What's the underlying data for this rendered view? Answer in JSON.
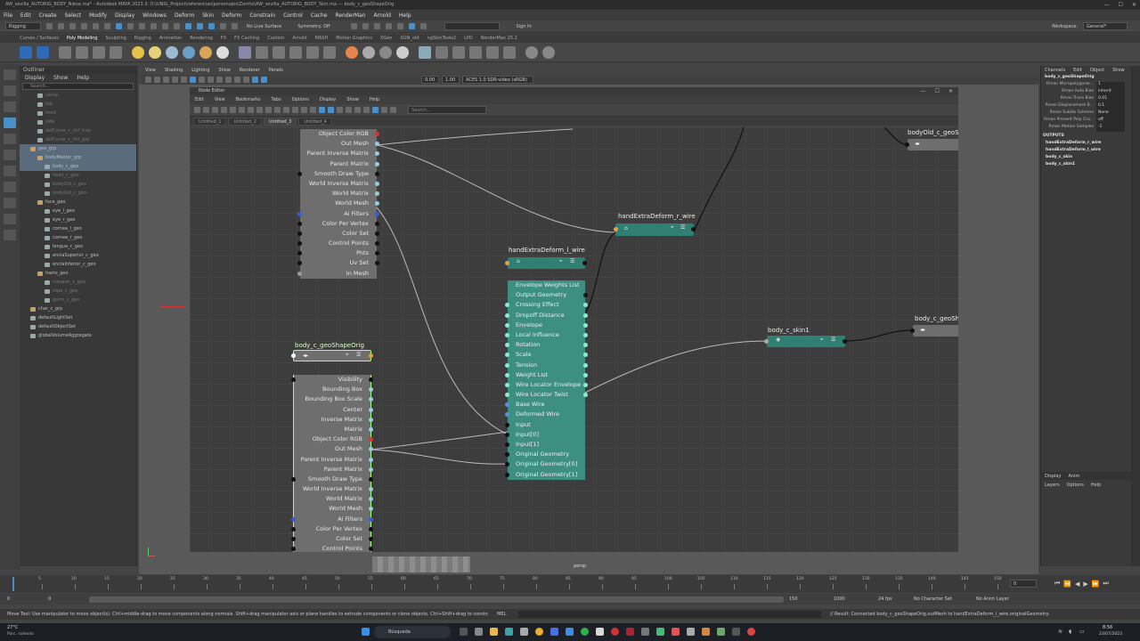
{
  "app": {
    "title": "AW_sevilla_AUTORIG_BODY_Nieve.ma* - Autodesk MAYA 2023.3: D:\\UNIG_Project\\referencias\\personajes\\Zorrito\\AW_sevilla_AUTORIG_BODY_Skin.ma  ---  body_c_geoShapeOrig"
  },
  "menubar": [
    "File",
    "Edit",
    "Create",
    "Select",
    "Modify",
    "Display",
    "Windows",
    "Deform",
    "Skin",
    "Deform",
    "Constrain",
    "Control",
    "Cache",
    "RenderMan",
    "Arnold",
    "Help"
  ],
  "statusline": {
    "mode": "Rigging",
    "live_surface": "No Live Surface",
    "symmetry": "Symmetry: Off",
    "sign_in": "Sign In",
    "workspace_label": "Workspace:",
    "workspace": "General*"
  },
  "shelf_tabs": [
    {
      "label": "Curves / Surfaces",
      "active": false
    },
    {
      "label": "Poly Modeling",
      "active": true
    },
    {
      "label": "Sculpting",
      "active": false
    },
    {
      "label": "Rigging",
      "active": false
    },
    {
      "label": "Animation",
      "active": false
    },
    {
      "label": "Rendering",
      "active": false
    },
    {
      "label": "FX",
      "active": false
    },
    {
      "label": "FX Caching",
      "active": false
    },
    {
      "label": "Custom",
      "active": false
    },
    {
      "label": "Arnold",
      "active": false
    },
    {
      "label": "MASH",
      "active": false
    },
    {
      "label": "Motion Graphics",
      "active": false
    },
    {
      "label": "XGen",
      "active": false
    },
    {
      "label": "XGN_old",
      "active": false
    },
    {
      "label": "ngSkinTools2",
      "active": false
    },
    {
      "label": "LPD",
      "active": false
    },
    {
      "label": "RenderMan 25.2",
      "active": false
    }
  ],
  "outliner": {
    "title": "Outliner",
    "menu": [
      "Display",
      "Show",
      "Help"
    ],
    "search_placeholder": "Search...",
    "items": [
      {
        "label": "camp",
        "indent": 2,
        "dim": true,
        "sel": false,
        "grp": false
      },
      {
        "label": "top",
        "indent": 2,
        "dim": true,
        "sel": false,
        "grp": false
      },
      {
        "label": "front",
        "indent": 2,
        "dim": true,
        "sel": false,
        "grp": false
      },
      {
        "label": "side",
        "indent": 2,
        "dim": true,
        "sel": false,
        "grp": false
      },
      {
        "label": "defCurve_c_ctrl_tmp",
        "indent": 2,
        "dim": true,
        "sel": false,
        "grp": false
      },
      {
        "label": "defCurve_c_ctrl_grp",
        "indent": 2,
        "dim": true,
        "sel": false,
        "grp": false
      },
      {
        "label": "geo_grp",
        "indent": 1,
        "dim": false,
        "sel": true,
        "grp": true
      },
      {
        "label": "bodyMaster_grp",
        "indent": 2,
        "dim": false,
        "sel": true,
        "grp": true
      },
      {
        "label": "body_c_geo",
        "indent": 3,
        "dim": false,
        "sel": true,
        "grp": false
      },
      {
        "label": "head_c_geo",
        "indent": 3,
        "dim": true,
        "sel": false,
        "grp": false
      },
      {
        "label": "bodyOld_c_geo",
        "indent": 3,
        "dim": true,
        "sel": false,
        "grp": false
      },
      {
        "label": "bodyOld_c_geo",
        "indent": 3,
        "dim": true,
        "sel": false,
        "grp": false
      },
      {
        "label": "face_geo",
        "indent": 2,
        "dim": false,
        "sel": false,
        "grp": true
      },
      {
        "label": "eye_l_geo",
        "indent": 3,
        "dim": false,
        "sel": false,
        "grp": false
      },
      {
        "label": "eye_r_geo",
        "indent": 3,
        "dim": false,
        "sel": false,
        "grp": false
      },
      {
        "label": "cornea_l_geo",
        "indent": 3,
        "dim": false,
        "sel": false,
        "grp": false
      },
      {
        "label": "cornea_r_geo",
        "indent": 3,
        "dim": false,
        "sel": false,
        "grp": false
      },
      {
        "label": "lengua_c_geo",
        "indent": 3,
        "dim": false,
        "sel": false,
        "grp": false
      },
      {
        "label": "encíaSuperior_c_geo",
        "indent": 3,
        "dim": false,
        "sel": false,
        "grp": false
      },
      {
        "label": "encíaInferior_c_geo",
        "indent": 3,
        "dim": false,
        "sel": false,
        "grp": false
      },
      {
        "label": "hams_geo",
        "indent": 2,
        "dim": false,
        "sel": false,
        "grp": true
      },
      {
        "label": "mesaon_c_geo",
        "indent": 3,
        "dim": true,
        "sel": false,
        "grp": false
      },
      {
        "label": "ropa_c_geo",
        "indent": 3,
        "dim": true,
        "sel": false,
        "grp": false
      },
      {
        "label": "gorro_c_geo",
        "indent": 3,
        "dim": true,
        "sel": false,
        "grp": false
      },
      {
        "label": "char_c_grp",
        "indent": 1,
        "dim": false,
        "sel": false,
        "grp": true
      },
      {
        "label": "defaultLightSet",
        "indent": 1,
        "dim": false,
        "sel": false,
        "grp": false
      },
      {
        "label": "defaultObjectSet",
        "indent": 1,
        "dim": false,
        "sel": false,
        "grp": false
      },
      {
        "label": "globalVolumeAggregate",
        "indent": 1,
        "dim": false,
        "sel": false,
        "grp": false
      }
    ]
  },
  "viewport": {
    "menu": [
      "View",
      "Shading",
      "Lighting",
      "Show",
      "Renderer",
      "Panels"
    ],
    "exposure": "0.00",
    "gamma": "1.00",
    "colorspace": "ACES 1.0 SDR-video (sRGB)",
    "camera": "persp"
  },
  "node_editor": {
    "title": "Node Editor",
    "menu": [
      "Edit",
      "View",
      "Bookmarks",
      "Tabs",
      "Options",
      "Display",
      "Show",
      "Help"
    ],
    "search_placeholder": "Search...",
    "tabs": [
      {
        "label": "Untitled_1",
        "active": false
      },
      {
        "label": "Untitled_2",
        "active": false
      },
      {
        "label": "Untitled_3",
        "active": true
      },
      {
        "label": "Untitled_4",
        "active": false
      }
    ],
    "nodes": {
      "upper": {
        "attrs": [
          "Object Color RGB",
          "Out Mesh",
          "Parent Inverse Matrix",
          "Parent Matrix",
          "Smooth Draw Type",
          "World Inverse Matrix",
          "World Matrix",
          "World Mesh",
          "Ai Filters",
          "Color Per Vertex",
          "Color Set",
          "Control Points",
          "Pnts",
          "Uv Set",
          "In Mesh"
        ]
      },
      "orig": {
        "title": "body_c_geoShapeOrig",
        "attrs": [
          "Visibility",
          "Bounding Box",
          "Bounding Box Scale",
          "Center",
          "Inverse Matrix",
          "Matrix",
          "Object Color RGB",
          "Out Mesh",
          "Parent Inverse Matrix",
          "Parent Matrix",
          "Smooth Draw Type",
          "World Inverse Matrix",
          "World Matrix",
          "World Mesh",
          "Ai Filters",
          "Color Per Vertex",
          "Color Set",
          "Control Points"
        ]
      },
      "wire_l": {
        "title": "handExtraDeform_l_wire",
        "attrs": [
          "Envelope Weights List",
          "Output Geometry",
          "Crossing Effect",
          "Dropoff Distance",
          "Envelope",
          "Local Influence",
          "Rotation",
          "Scale",
          "Tension",
          "Weight List",
          "Wire Locator Envelope",
          "Wire Locator Twist",
          "Base Wire",
          "Deformed Wire",
          "Input",
          "Input[0]",
          "Input[1]",
          "Original Geometry",
          "Original Geometry[0]",
          "Original Geometry[1]"
        ]
      },
      "wire_r": {
        "title": "handExtraDeform_r_wire"
      },
      "skin": {
        "title": "body_c_skin1"
      },
      "bodyold": {
        "title": "bodyOld_c_geoS"
      },
      "geosh": {
        "title": "body_c_geoSh"
      }
    }
  },
  "channel_box": {
    "menu": [
      "Channels",
      "Edit",
      "Object",
      "Show"
    ],
    "node": "body_c_geoShapeOrig",
    "rows": [
      {
        "k": "Rman Micropolygonle...",
        "v": "1"
      },
      {
        "k": "Rman Auto Bias",
        "v": "inherit"
      },
      {
        "k": "Rman Trace Bias",
        "v": "0.01"
      },
      {
        "k": "Rman Displacement B...",
        "v": "0.1"
      },
      {
        "k": "Rman Subdiv Scheme",
        "v": "None"
      },
      {
        "k": "Rman Prevent Poly Cra...",
        "v": "off"
      },
      {
        "k": "Rman Motion Samples",
        "v": "-1"
      }
    ],
    "outputs_label": "OUTPUTS",
    "outputs": [
      "handExtraDeform_r_wire",
      "handExtraDeform_l_wire",
      "body_c_skin",
      "body_c_skin1"
    ],
    "layers_tabs": [
      "Display",
      "Anim"
    ],
    "layers_menu": [
      "Layers",
      "Options",
      "Help"
    ]
  },
  "time": {
    "start": "0",
    "current": "0",
    "range_start": "1",
    "range_end": "150",
    "anim_end": "1000",
    "fps": "24 fps",
    "char_set": "No Character Set",
    "anim_layer": "No Anim Layer",
    "ticks": [
      "5",
      "10",
      "15",
      "20",
      "25",
      "30",
      "35",
      "40",
      "45",
      "50",
      "55",
      "60",
      "65",
      "70",
      "75",
      "80",
      "85",
      "90",
      "95",
      "100",
      "105",
      "110",
      "115",
      "120",
      "125",
      "130",
      "135",
      "140",
      "145",
      "150"
    ]
  },
  "cmdline": {
    "lang": "MEL",
    "help": "Move Tool: Use manipulator to move object(s). Ctrl+middle-drag to move components along normals. Shift+drag manipulator axis or plane handles to extrude components or clone objects. Ctrl+Shift+drag to constrain movement to a co",
    "result": "// Result: Connected body_c_geoShapeOrig.outMesh to handExtraDeform_l_wire.originalGeometry."
  },
  "taskbar": {
    "weather_temp": "27°C",
    "weather_desc": "Parc. soleado",
    "search": "Búsqueda",
    "time": "8:56",
    "date": "23/07/2023"
  },
  "colors": {
    "teal_node": "#3d8f80",
    "teal_head": "#2f7f73",
    "gray_node": "#6e6e6e",
    "select_green": "#a6ff7a",
    "accent_blue": "#4a8fc8"
  }
}
